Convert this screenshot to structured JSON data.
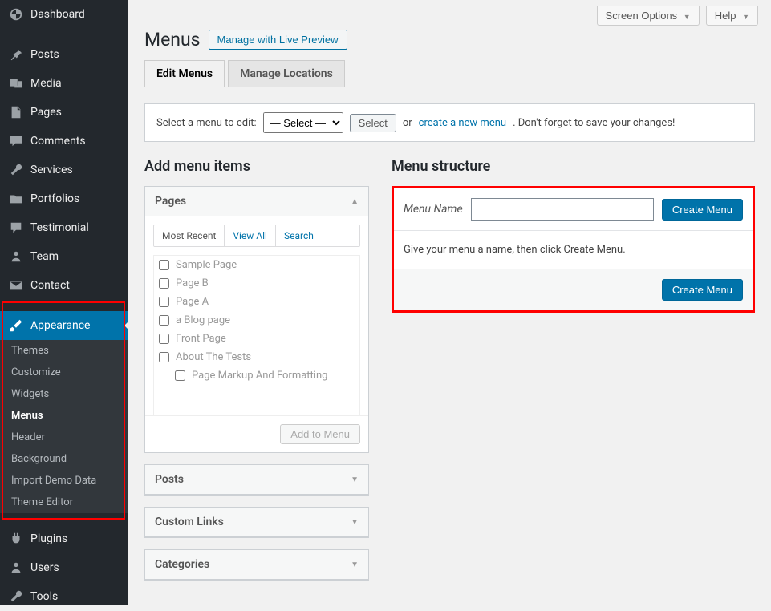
{
  "topbar": {
    "screen_options": "Screen Options",
    "help": "Help"
  },
  "page": {
    "title": "Menus",
    "live_preview_btn": "Manage with Live Preview",
    "tabs": {
      "edit": "Edit Menus",
      "locations": "Manage Locations"
    },
    "select_label": "Select a menu to edit:",
    "select_placeholder": "— Select —",
    "select_btn": "Select",
    "or_text": "or",
    "create_link": "create a new menu",
    "save_warning": ". Don't forget to save your changes!"
  },
  "sidebar": {
    "dashboard": "Dashboard",
    "posts": "Posts",
    "media": "Media",
    "pages": "Pages",
    "comments": "Comments",
    "services": "Services",
    "portfolios": "Portfolios",
    "testimonial": "Testimonial",
    "team": "Team",
    "contact": "Contact",
    "appearance": "Appearance",
    "plugins": "Plugins",
    "users": "Users",
    "tools": "Tools",
    "submenu": {
      "themes": "Themes",
      "customize": "Customize",
      "widgets": "Widgets",
      "menus": "Menus",
      "header": "Header",
      "background": "Background",
      "import": "Import Demo Data",
      "theme_editor": "Theme Editor"
    }
  },
  "add_items": {
    "title": "Add menu items",
    "pages_head": "Pages",
    "tabs": {
      "recent": "Most Recent",
      "view_all": "View All",
      "search": "Search"
    },
    "pages": [
      "Sample Page",
      "Page B",
      "Page A",
      "a Blog page",
      "Front Page",
      "About The Tests",
      "Page Markup And Formatting"
    ],
    "add_btn": "Add to Menu",
    "posts_head": "Posts",
    "custom_links_head": "Custom Links",
    "categories_head": "Categories"
  },
  "structure": {
    "title": "Menu structure",
    "name_label": "Menu Name",
    "create_btn": "Create Menu",
    "body_text": "Give your menu a name, then click Create Menu."
  }
}
